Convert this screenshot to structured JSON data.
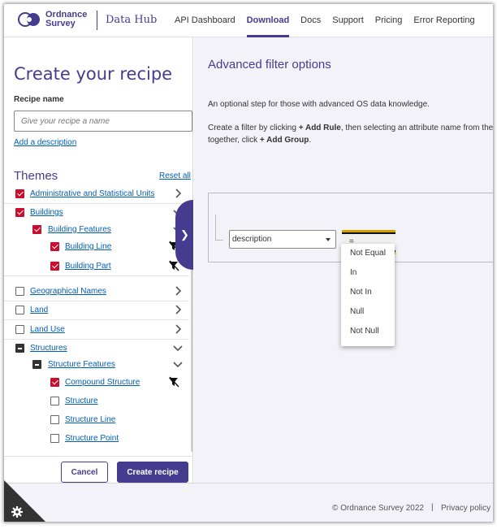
{
  "header": {
    "logo_line1": "Ordnance",
    "logo_line2": "Survey",
    "product": "Data Hub",
    "nav": [
      {
        "label": "API Dashboard"
      },
      {
        "label": "Download"
      },
      {
        "label": "Docs"
      },
      {
        "label": "Support"
      },
      {
        "label": "Pricing"
      },
      {
        "label": "Error Reporting"
      }
    ],
    "active_nav": "Download"
  },
  "recipe": {
    "title": "Create your recipe",
    "name_label": "Recipe name",
    "name_placeholder": "Give your recipe a name",
    "add_description": "Add a description",
    "themes_title": "Themes",
    "reset_all": "Reset all",
    "tree": [
      {
        "label": "Administrative and Statistical Units",
        "state": "checked",
        "chevron": "right"
      },
      {
        "label": "Buildings",
        "state": "checked",
        "chevron": "down"
      },
      {
        "label": "Building Features",
        "state": "checked",
        "chevron": "down"
      },
      {
        "label": "Building Line",
        "state": "checked",
        "filtered": true
      },
      {
        "label": "Building Part",
        "state": "checked",
        "filtered": true
      },
      {
        "label": "Geographical Names",
        "state": "unchecked",
        "chevron": "right"
      },
      {
        "label": "Land",
        "state": "unchecked",
        "chevron": "right"
      },
      {
        "label": "Land Use",
        "state": "unchecked",
        "chevron": "right"
      },
      {
        "label": "Structures",
        "state": "partial",
        "chevron": "down"
      },
      {
        "label": "Structure Features",
        "state": "partial",
        "chevron": "down"
      },
      {
        "label": "Compound Structure",
        "state": "checked",
        "filtered": true
      },
      {
        "label": "Structure",
        "state": "unchecked"
      },
      {
        "label": "Structure Line",
        "state": "unchecked"
      },
      {
        "label": "Structure Point",
        "state": "unchecked"
      }
    ],
    "cancel": "Cancel",
    "create": "Create recipe"
  },
  "advanced": {
    "title": "Advanced filter options",
    "intro": "An optional step for those with advanced OS data knowledge.",
    "instr_a": "Create a filter by clicking ",
    "instr_add_rule": "+ Add Rule",
    "instr_b": ", then selecting an attribute name from the",
    "instr_c": "together, click ",
    "instr_add_group": "+ Add Group",
    "instr_d": ".",
    "attribute_value": "description",
    "operator_value": "=",
    "operator_options": [
      "Not Equal",
      "In",
      "Not In",
      "Null",
      "Not Null"
    ]
  },
  "footer": {
    "copyright": "© Ordnance Survey 2022",
    "separator": "|",
    "privacy": "Privacy policy"
  },
  "colors": {
    "brand": "#453c90",
    "checkbox": "#c8102e",
    "link": "#005eb8",
    "focus": "#d4a200"
  }
}
